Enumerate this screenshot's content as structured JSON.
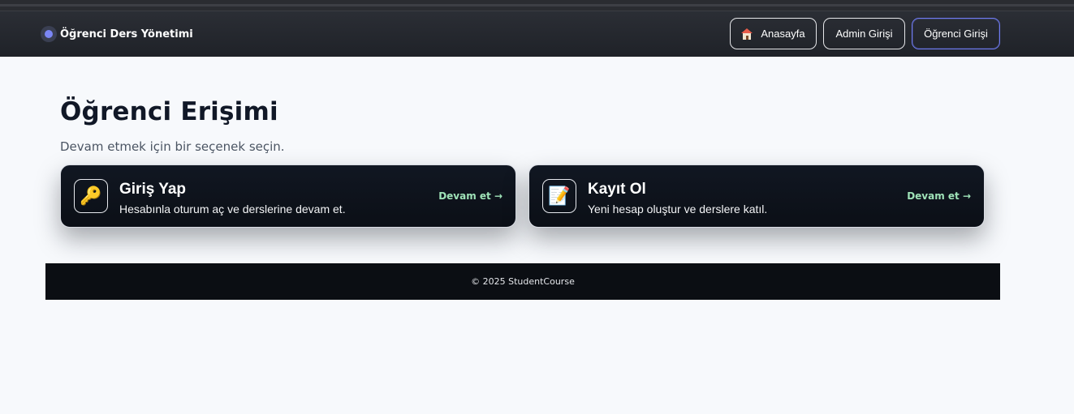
{
  "brand": {
    "name": "Öğrenci Ders Yönetimi"
  },
  "nav": {
    "home_label": "Anasayfa",
    "admin_label": "Admin Girişi",
    "student_label": "Öğrenci Girişi"
  },
  "page": {
    "title": "Öğrenci Erişimi",
    "subtitle": "Devam etmek için bir seçenek seçin."
  },
  "cards": [
    {
      "icon": "key-icon",
      "title": "Giriş Yap",
      "description": "Hesabınla oturum aç ve derslerine devam et.",
      "cta": "Devam et →"
    },
    {
      "icon": "memo-icon",
      "title": "Kayıt Ol",
      "description": "Yeni hesap oluştur ve derslere katıl.",
      "cta": "Devam et →"
    }
  ],
  "footer": {
    "text": "© 2025 StudentCourse"
  },
  "colors": {
    "accent": "#6f7bf0",
    "card_bg": "#0f141d",
    "cta": "#9fe3b8",
    "page_bg": "#f7f9fc"
  }
}
